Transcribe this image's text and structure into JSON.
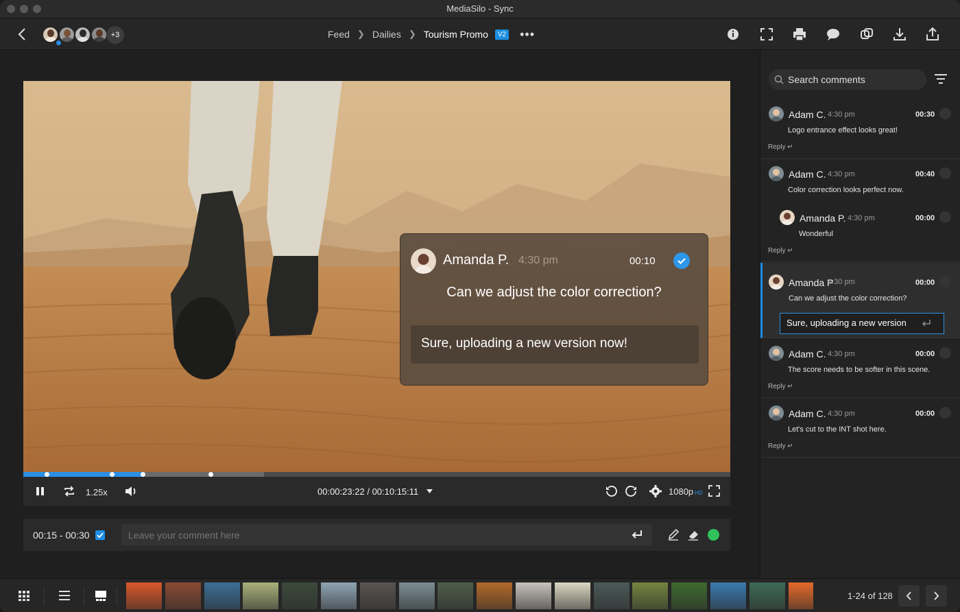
{
  "window": {
    "app_name": "MediaSilo",
    "separator": "-",
    "app_section": "Sync"
  },
  "header": {
    "more_collaborators": "+3",
    "breadcrumb": [
      "Feed",
      "Dailies",
      "Tourism Promo"
    ],
    "version_badge": "V2",
    "more_menu": "•••",
    "icons": [
      "info-icon",
      "fullscreen-icon",
      "print-icon",
      "comments-icon",
      "compare-icon",
      "download-icon",
      "upload-icon"
    ]
  },
  "player": {
    "speed": "1.25x",
    "current_time": "00:00:23:22",
    "duration": "00:10:15:11",
    "time_separator": "/",
    "quality": "1080p",
    "quality_badge": "HD",
    "progress_played": 0.17,
    "progress_loaded": 0.34
  },
  "overlay": {
    "author": "Amanda P.",
    "time": "4:30 pm",
    "timecode": "00:10",
    "message": "Can we adjust the color correction?",
    "reply": "Sure, uploading a new version now!"
  },
  "comment_bar": {
    "range": "00:15 - 00:30",
    "placeholder": "Leave your comment here",
    "accent": "#2fc25a"
  },
  "panel": {
    "search_placeholder": "Search comments",
    "reply_label": "Reply",
    "comments": [
      {
        "author": "Adam C.",
        "time": "4:30 pm",
        "timecode": "00:30",
        "text": "Logo entrance effect looks great!"
      },
      {
        "author": "Adam C.",
        "time": "4:30 pm",
        "timecode": "00:40",
        "text": "Color correction looks perfect now."
      },
      {
        "author": "Amanda P.",
        "time": "4:30 pm",
        "timecode": "00:00",
        "text": "Wonderful"
      },
      {
        "author": "Amanda P",
        "time": "4:30 pm",
        "timecode": "00:00",
        "text": "Can we adjust the color correction?"
      },
      {
        "author": "Adam C.",
        "time": "4:30 pm",
        "timecode": "00:00",
        "text": "The score needs to be softer in this scene."
      },
      {
        "author": "Adam C.",
        "time": "4:30 pm",
        "timecode": "00:00",
        "text": "Let's cut to the INT shot here."
      }
    ],
    "reply_draft": "Sure, uploading a new version"
  },
  "strip": {
    "pager": "1-24 of 128",
    "thumb_colors": [
      "#d9582a",
      "#8a4a34",
      "#3d6f96",
      "#a9b07a",
      "#3c4a3c",
      "#8fa4b3",
      "#5a5450",
      "#7c8d93",
      "#4e5d4a",
      "#b36a2a",
      "#c9c3bc",
      "#dcd8c4",
      "#4b5a58",
      "#75843f",
      "#3f6a2f",
      "#3a7bb0",
      "#3d6a55",
      "#e46a2a"
    ]
  },
  "colors": {
    "accent": "#1f8ee6",
    "background": "#1f1f1f"
  }
}
